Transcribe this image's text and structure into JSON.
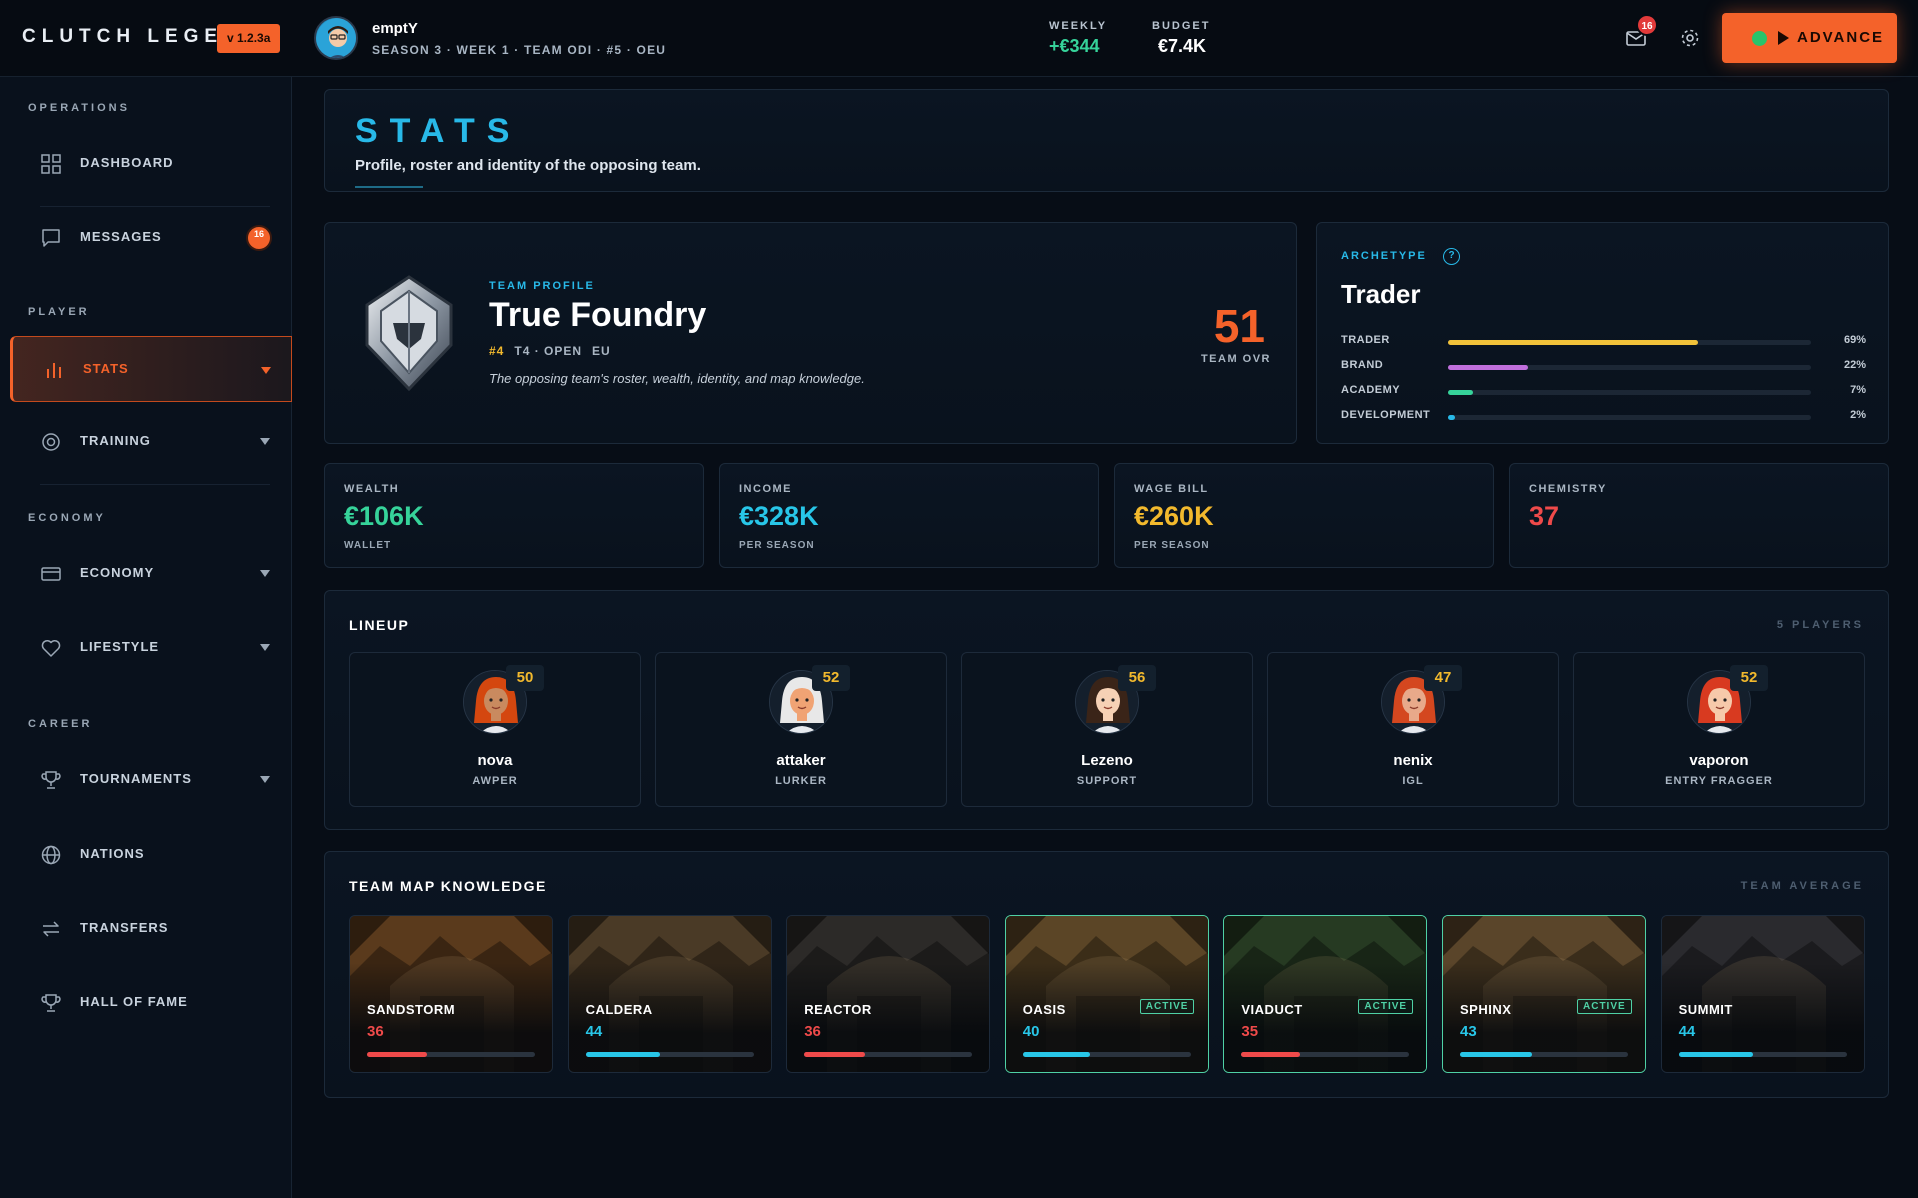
{
  "app": {
    "logo": "CLUTCH LEGEND",
    "version": "v 1.2.3a",
    "user": {
      "name": "emptY",
      "subtitle": "SEASON 3 · WEEK 1 · TEAM ODI · #5 · OEU"
    },
    "weekly": {
      "label": "WEEKLY",
      "value": "+€344"
    },
    "budget": {
      "label": "BUDGET",
      "value": "€7.4K"
    },
    "mail_count": "16",
    "advance_label": "ADVANCE"
  },
  "sidebar": {
    "sections": [
      "OPERATIONS",
      "PLAYER",
      "ECONOMY",
      "CAREER"
    ],
    "items": [
      {
        "label": "DASHBOARD",
        "icon": "grid-icon"
      },
      {
        "label": "MESSAGES",
        "icon": "message-icon",
        "badge": "16"
      },
      {
        "label": "STATS",
        "icon": "bar-chart-icon",
        "active": true
      },
      {
        "label": "TRAINING",
        "icon": "target-icon"
      },
      {
        "label": "ECONOMY",
        "icon": "card-icon"
      },
      {
        "label": "LIFESTYLE",
        "icon": "heart-icon"
      },
      {
        "label": "TOURNAMENTS",
        "icon": "trophy-icon"
      },
      {
        "label": "NATIONS",
        "icon": "globe-icon"
      },
      {
        "label": "TRANSFERS",
        "icon": "swap-icon"
      },
      {
        "label": "HALL OF FAME",
        "icon": "trophy-icon"
      }
    ]
  },
  "page": {
    "title": "STATS",
    "subtitle": "Profile, roster and identity of the opposing team."
  },
  "team": {
    "label": "TEAM PROFILE",
    "name": "True Foundry",
    "rank": "#4",
    "tier": "T4 · OPEN",
    "region": "EU",
    "description": "The opposing team's roster, wealth, identity, and map knowledge.",
    "ovr": "51",
    "ovr_label": "TEAM OVR"
  },
  "archetype": {
    "label": "ARCHETYPE",
    "help": "?",
    "name": "Trader",
    "rows": [
      {
        "name": "TRADER",
        "pct": "69%",
        "value": 0.69,
        "color": "#f2c23a"
      },
      {
        "name": "BRAND",
        "pct": "22%",
        "value": 0.22,
        "color": "#c06fdc"
      },
      {
        "name": "ACADEMY",
        "pct": "7%",
        "value": 0.07,
        "color": "#36d39a"
      },
      {
        "name": "DEVELOPMENT",
        "pct": "2%",
        "value": 0.02,
        "color": "#28b9e8"
      }
    ]
  },
  "kpis": [
    {
      "label": "WEALTH",
      "value": "€106K",
      "sub": "WALLET",
      "color": "#36d39a"
    },
    {
      "label": "INCOME",
      "value": "€328K",
      "sub": "PER SEASON",
      "color": "#28c6e8"
    },
    {
      "label": "WAGE BILL",
      "value": "€260K",
      "sub": "PER SEASON",
      "color": "#f2b92d"
    },
    {
      "label": "CHEMISTRY",
      "value": "37",
      "sub": "",
      "color": "#ef4a4a"
    }
  ],
  "lineup": {
    "title": "LINEUP",
    "count": "5 PLAYERS",
    "players": [
      {
        "name": "nova",
        "role": "AWPER",
        "ovr": "50",
        "hair": "#d4470f",
        "skin": "#c98a5f"
      },
      {
        "name": "attaker",
        "role": "LURKER",
        "ovr": "52",
        "hair": "#e8e8e8",
        "skin": "#f0a374"
      },
      {
        "name": "Lezeno",
        "role": "SUPPORT",
        "ovr": "56",
        "hair": "#3a2418",
        "skin": "#f6d1b5"
      },
      {
        "name": "nenix",
        "role": "IGL",
        "ovr": "47",
        "hair": "#d4471f",
        "skin": "#e8a98a"
      },
      {
        "name": "vaporon",
        "role": "ENTRY FRAGGER",
        "ovr": "52",
        "hair": "#d83a20",
        "skin": "#f6c9aa"
      }
    ]
  },
  "maps": {
    "title": "TEAM MAP KNOWLEDGE",
    "note": "TEAM AVERAGE",
    "items": [
      {
        "name": "SANDSTORM",
        "value": "36",
        "level": 0.36,
        "color": "#ef4a4a",
        "active": false,
        "tone": "#5a3a1c"
      },
      {
        "name": "CALDERA",
        "value": "44",
        "level": 0.44,
        "color": "#28c6e8",
        "active": false,
        "tone": "#4a3a26"
      },
      {
        "name": "REACTOR",
        "value": "36",
        "level": 0.36,
        "color": "#ef4a4a",
        "active": false,
        "tone": "#2c2a28"
      },
      {
        "name": "OASIS",
        "value": "40",
        "level": 0.4,
        "color": "#28c6e8",
        "active": true,
        "badge": "ACTIVE",
        "tone": "#5b4526"
      },
      {
        "name": "VIADUCT",
        "value": "35",
        "level": 0.35,
        "color": "#ef4a4a",
        "active": true,
        "badge": "ACTIVE",
        "tone": "#263a22"
      },
      {
        "name": "SPHINX",
        "value": "43",
        "level": 0.43,
        "color": "#28c6e8",
        "active": true,
        "badge": "ACTIVE",
        "tone": "#5a452a"
      },
      {
        "name": "SUMMIT",
        "value": "44",
        "level": 0.44,
        "color": "#28c6e8",
        "active": false,
        "tone": "#2a2a2e"
      }
    ]
  }
}
